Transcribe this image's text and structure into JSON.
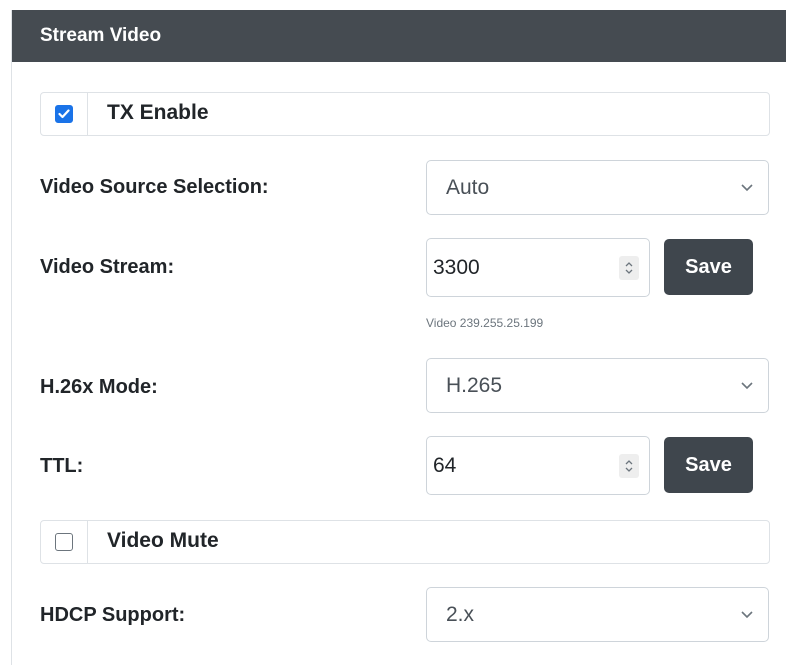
{
  "panel": {
    "title": "Stream Video"
  },
  "tx_enable": {
    "label": "TX Enable",
    "checked": true
  },
  "video_source": {
    "label": "Video Source Selection:",
    "value": "Auto"
  },
  "video_stream": {
    "label": "Video Stream:",
    "value": "3300",
    "save_label": "Save",
    "helper": "Video 239.255.25.199"
  },
  "h26x_mode": {
    "label": "H.26x Mode:",
    "value": "H.265"
  },
  "ttl": {
    "label": "TTL:",
    "value": "64",
    "save_label": "Save"
  },
  "video_mute": {
    "label": "Video Mute",
    "checked": false
  },
  "hdcp_support": {
    "label": "HDCP Support:",
    "value": "2.x"
  },
  "colors": {
    "header_bg": "#454b51",
    "checkbox_checked": "#1a73e8",
    "save_button_bg": "#3f464d"
  },
  "icons": {
    "checkbox_checked": "check-icon",
    "select_arrow": "chevron-down-icon",
    "spinner": "spinner-arrows-icon"
  }
}
